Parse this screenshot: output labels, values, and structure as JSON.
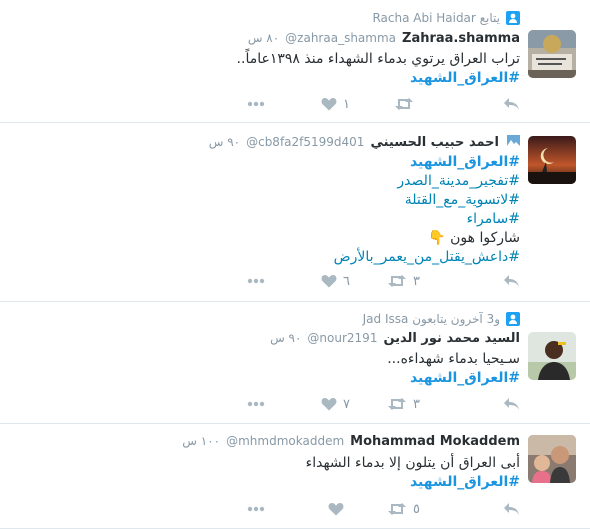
{
  "tweets": [
    {
      "context": "Racha Abi Haidar يتابع",
      "name": "Zahraa.shamma",
      "handle": "@zahraa_shamma",
      "time": "٨٠ س",
      "lines": [
        "تراب العراق يرتوي بدماء الشهداء منذ ١٣٩٨عاماً.."
      ],
      "hashtags": [
        "#العراق_الشهيد"
      ],
      "retweets": "",
      "likes": "١"
    },
    {
      "context": "",
      "name": "احمد حبيب الحسيني",
      "handle": "@cb8fa2f5199d401",
      "time": "٩٠ س",
      "lines": [
        "#العراق_الشهيد",
        "#تفجير_مدينة_الصدر",
        "#لاتسوية_مع_القتلة",
        "#سامراء",
        "شاركوا هون 👇",
        "#داعش_يقتل_من_يعمر_بالأرض"
      ],
      "hashtags": [],
      "retweets": "٣",
      "likes": "٦"
    },
    {
      "context": "Jad Issa و3 آخرون يتابعون",
      "name": "السيد محمد نور الدين",
      "handle": "@nour2191",
      "time": "٩٠ س",
      "lines": [
        "سـيحيا بدماء شهداءه..."
      ],
      "hashtags": [
        "#العراق_الشهيد"
      ],
      "retweets": "٣",
      "likes": "٧"
    },
    {
      "context": "",
      "name": "Mohammad Mokaddem",
      "handle": "@mhmdmokaddem",
      "time": "١٠٠ س",
      "lines": [
        "أبى العراق أن يتلون إلا بدماء الشهداء"
      ],
      "hashtags": [
        "#العراق_الشهيد"
      ],
      "retweets": "٥",
      "likes": ""
    }
  ],
  "icons": {
    "context": "person-follow-icon",
    "reply": "reply-icon",
    "retweet": "retweet-icon",
    "like": "heart-icon",
    "more": "more-dots-icon"
  },
  "colors": {
    "link": "#0084b4",
    "muted": "#8899a6",
    "icon": "#aab8c2"
  }
}
